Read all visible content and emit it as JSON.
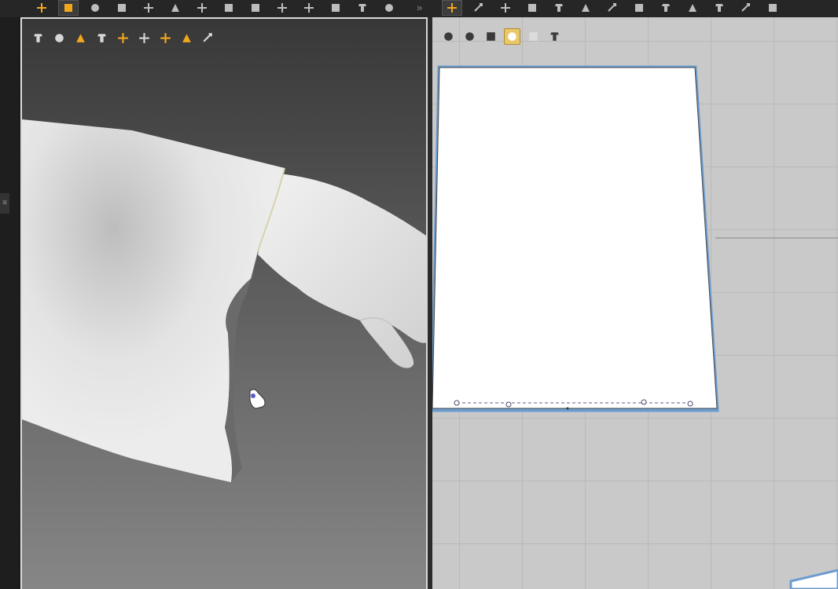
{
  "app": {
    "accent_color": "#f2a81d",
    "selection_color": "#6b9ccf"
  },
  "top_toolbar": {
    "left_tools": [
      {
        "name": "transform-pattern-icon",
        "active": false
      },
      {
        "name": "select-move-icon",
        "active": true
      },
      {
        "name": "fold-arrangement-icon",
        "active": false
      },
      {
        "name": "garment-shape-icon",
        "active": false
      },
      {
        "name": "tack-icon",
        "active": false
      },
      {
        "name": "pin-icon",
        "active": false
      },
      {
        "name": "camera-icon",
        "active": false
      },
      {
        "name": "avatar-arrange-icon",
        "active": false
      },
      {
        "name": "measure-icon",
        "active": false
      },
      {
        "name": "mesh-icon",
        "active": false
      },
      {
        "name": "trace-icon",
        "active": false
      },
      {
        "name": "brush-icon",
        "active": false
      },
      {
        "name": "gear-icon",
        "active": false
      },
      {
        "name": "list-icon",
        "active": false
      }
    ],
    "right_tools": [
      {
        "name": "edit-pattern-icon",
        "active": true
      },
      {
        "name": "bounding-box-icon",
        "active": false
      },
      {
        "name": "rectangle-icon",
        "active": false
      },
      {
        "name": "polygon-icon",
        "active": false
      },
      {
        "name": "dart-icon",
        "active": false
      },
      {
        "name": "internal-shape-icon",
        "active": false
      },
      {
        "name": "grid-mesh-icon",
        "active": false
      },
      {
        "name": "pleat-icon",
        "active": false
      },
      {
        "name": "fold-icon",
        "active": false
      },
      {
        "name": "sewing-icon",
        "active": false
      },
      {
        "name": "segment-icon",
        "active": false
      },
      {
        "name": "line-icon",
        "active": false
      },
      {
        "name": "shirt-icon",
        "active": false
      }
    ],
    "overflow_glyph": "»"
  },
  "left_strip": {
    "handle_glyph": "≡"
  },
  "viewport_3d": {
    "tools": [
      {
        "name": "texture-view-icon"
      },
      {
        "name": "garment-view-icon"
      },
      {
        "name": "stress-map-icon"
      },
      {
        "name": "avatar-view-icon"
      },
      {
        "name": "pattern-display-icon"
      },
      {
        "name": "fold-view-icon"
      },
      {
        "name": "skin-avatar-icon"
      },
      {
        "name": "globe-icon"
      },
      {
        "name": "export-icon"
      }
    ]
  },
  "pattern_window": {
    "tools": [
      {
        "name": "pen-tool-icon",
        "active": false
      },
      {
        "name": "shirt-view-icon",
        "active": false
      },
      {
        "name": "info-icon",
        "active": false
      },
      {
        "name": "pattern-fill-icon",
        "active": true
      },
      {
        "name": "copy-pattern-icon",
        "active": false
      },
      {
        "name": "export-pattern-icon",
        "active": false
      }
    ]
  }
}
